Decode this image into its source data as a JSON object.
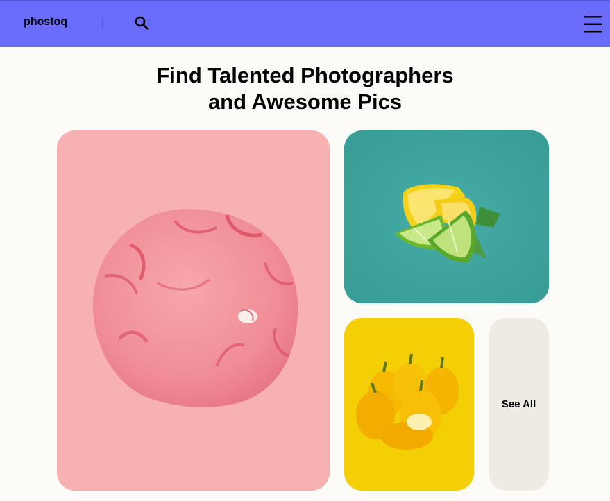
{
  "nav": {
    "brand": "phostoq",
    "search_icon": "search-icon",
    "menu_icon": "hamburger-menu-icon",
    "background": "#6a6cfc"
  },
  "hero": {
    "title_line1": "Find Talented Photographers",
    "title_line2": "and Awesome Pics"
  },
  "gallery": {
    "cards": [
      {
        "subject": "pink cookie",
        "background": "#f6b1b0"
      },
      {
        "subject": "lemon and lime slices",
        "background": "#3aa29b"
      },
      {
        "subject": "yellow bell peppers",
        "background": "#f5cf05"
      }
    ],
    "see_all_label": "See All",
    "see_all_background": "#f0ebe2"
  }
}
